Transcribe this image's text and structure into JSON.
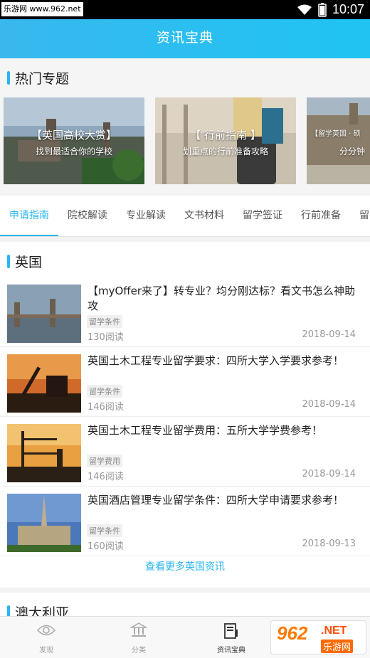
{
  "status_bar": {
    "watermark": "乐游网 www.962.net",
    "time": "10:07"
  },
  "app_bar": {
    "title": "资讯宝典"
  },
  "hot_topics": {
    "title": "热门专题",
    "banners": [
      {
        "title": "【英国高校大赏】",
        "subtitle": "找到最适合你的学校"
      },
      {
        "title": "【 行前指南 】",
        "subtitle": "划重点的行前准备攻略"
      },
      {
        "title": "【留学英国 · 硕",
        "subtitle": "分分钟"
      }
    ]
  },
  "tabs": [
    {
      "label": "申请指南",
      "active": true
    },
    {
      "label": "院校解读"
    },
    {
      "label": "专业解读"
    },
    {
      "label": "文书材料"
    },
    {
      "label": "留学签证"
    },
    {
      "label": "行前准备"
    },
    {
      "label": "留"
    }
  ],
  "uk_section": {
    "title": "英国",
    "articles": [
      {
        "title": "【myOffer来了】转专业？均分刚达标？看文书怎么神助攻",
        "tag": "留学条件",
        "reads": "130阅读",
        "date": "2018-09-14"
      },
      {
        "title": "英国土木工程专业留学要求：四所大学入学要求参考！",
        "tag": "留学条件",
        "reads": "146阅读",
        "date": "2018-09-14"
      },
      {
        "title": "英国土木工程专业留学费用：五所大学学费参考！",
        "tag": "留学费用",
        "reads": "146阅读",
        "date": "2018-09-14"
      },
      {
        "title": "英国酒店管理专业留学条件：四所大学申请要求参考！",
        "tag": "留学条件",
        "reads": "160阅读",
        "date": "2018-09-13"
      }
    ],
    "more_label": "查看更多英国资讯"
  },
  "australia_section": {
    "title": "澳大利亚"
  },
  "bottom_nav": [
    {
      "label": "发现",
      "icon": "eye-icon"
    },
    {
      "label": "分类",
      "icon": "bank-icon"
    },
    {
      "label": "资讯宝典",
      "icon": "news-icon",
      "active": true
    }
  ],
  "brand_logo": {
    "number": "962",
    "net": ".NET",
    "sub": "乐游网"
  },
  "colors": {
    "accent": "#29b6f0",
    "appbar": "#39b8ee"
  }
}
